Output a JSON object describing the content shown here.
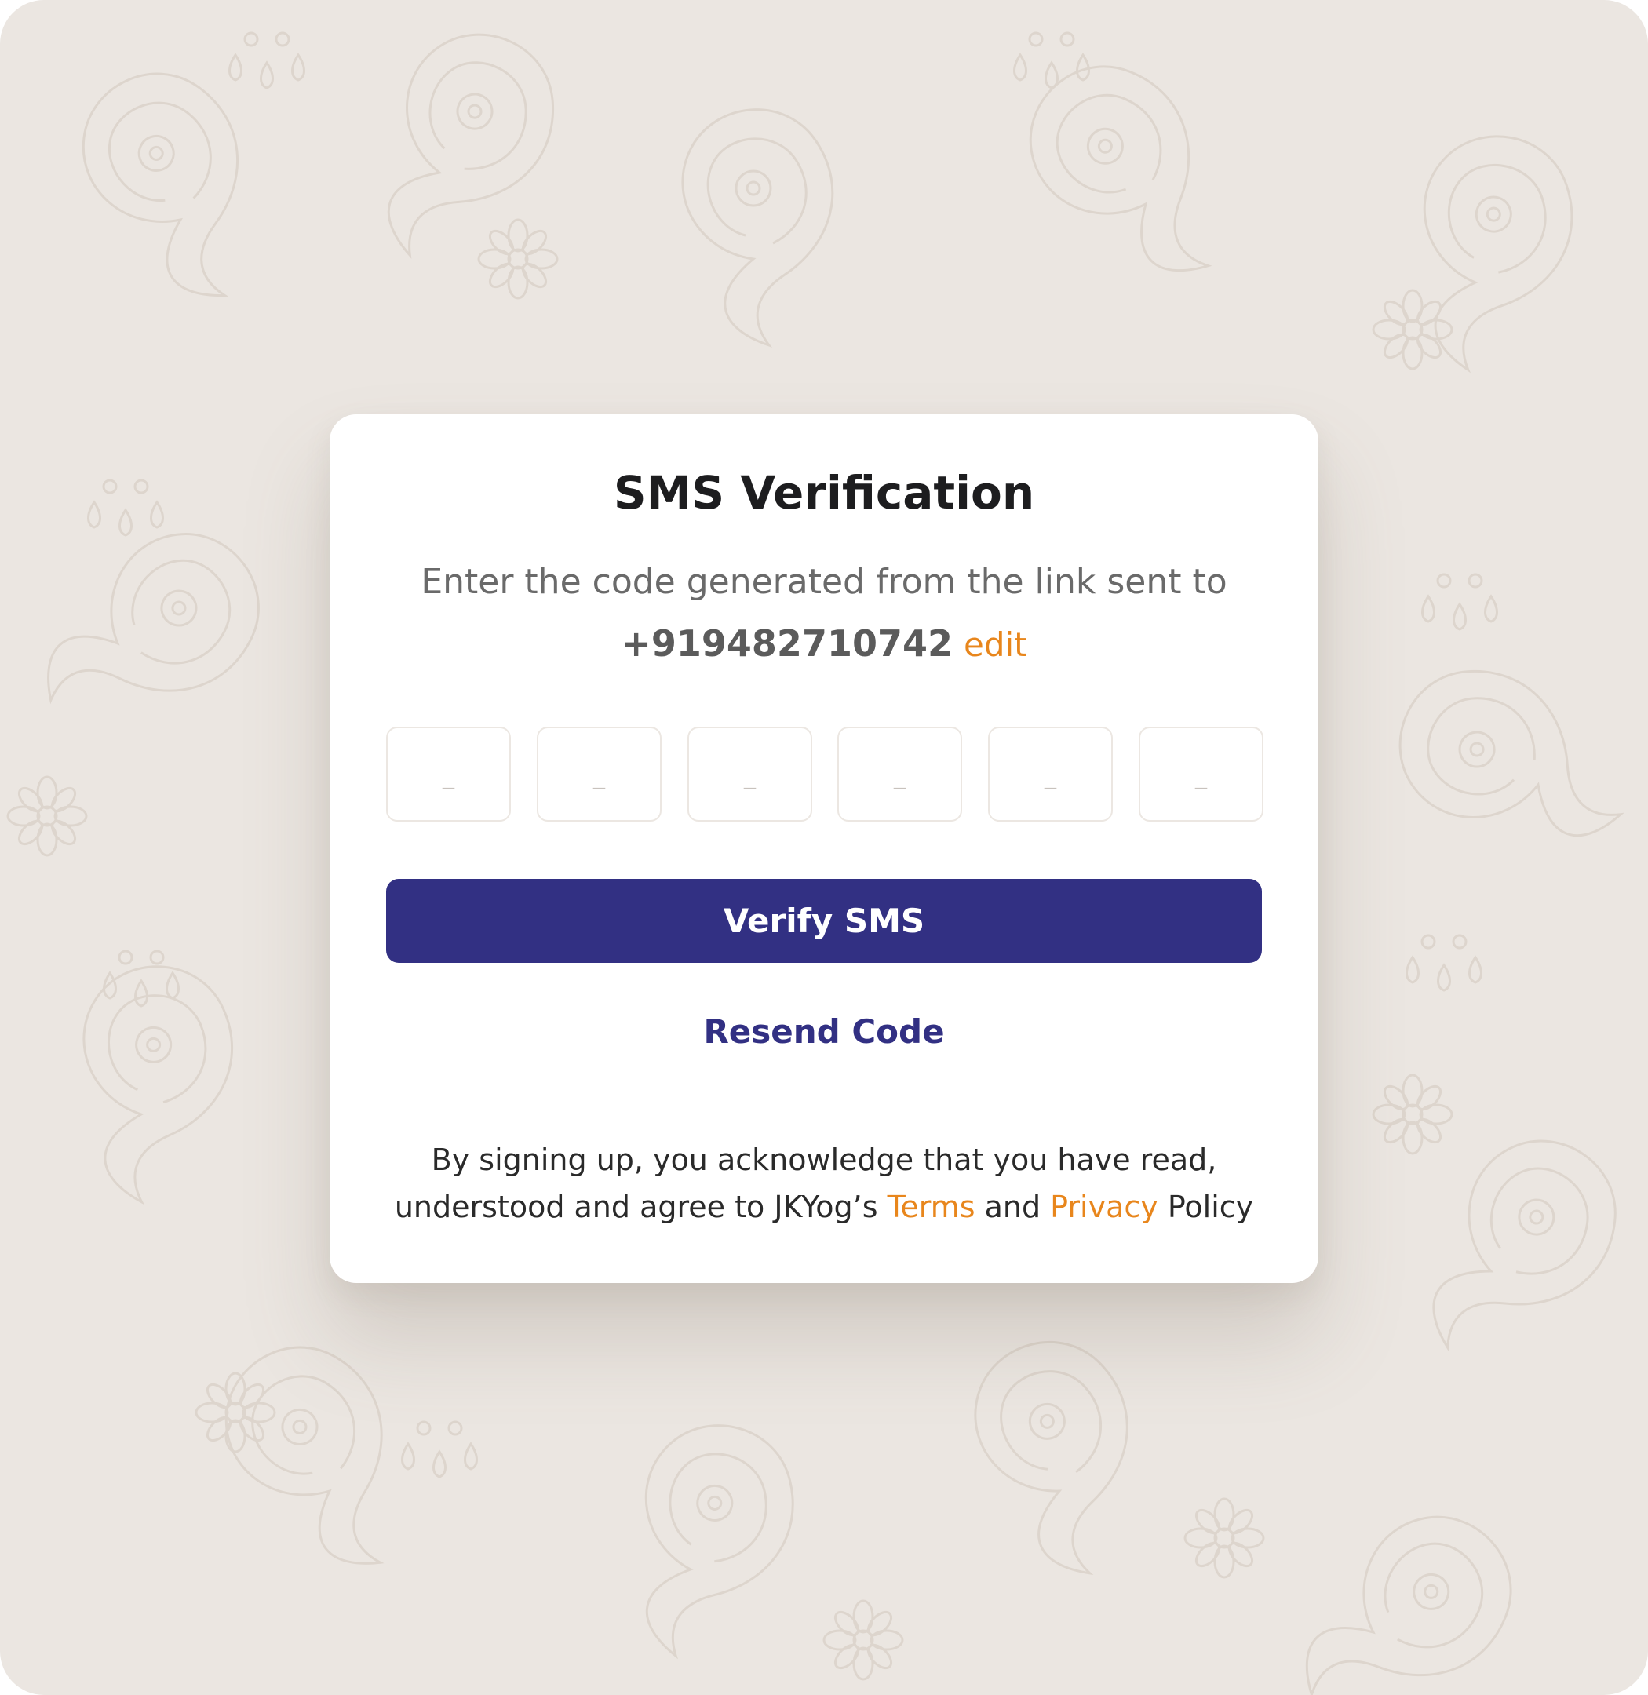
{
  "colors": {
    "background": "#ebe6e1",
    "pattern": "#ddd5cd",
    "card": "#ffffff",
    "primary": "#323083",
    "accent": "#e8861c",
    "heading": "#1d1d1f",
    "muted": "#6a6a6a"
  },
  "dialog": {
    "title": "SMS Verification",
    "subtitle": "Enter the code generated from the link sent to",
    "phone": "+919482710742",
    "edit_label": "edit",
    "code_boxes": [
      {
        "placeholder": "_"
      },
      {
        "placeholder": "_"
      },
      {
        "placeholder": "_"
      },
      {
        "placeholder": "_"
      },
      {
        "placeholder": "_"
      },
      {
        "placeholder": "_"
      }
    ],
    "verify_label": "Verify SMS",
    "resend_label": "Resend Code",
    "legal": {
      "line1": "By signing up, you acknowledge that you have read,",
      "line2_prefix": "understood and agree to JKYog’s ",
      "terms_label": "Terms",
      "connector": " and ",
      "privacy_label": "Privacy",
      "suffix": " Policy"
    }
  }
}
